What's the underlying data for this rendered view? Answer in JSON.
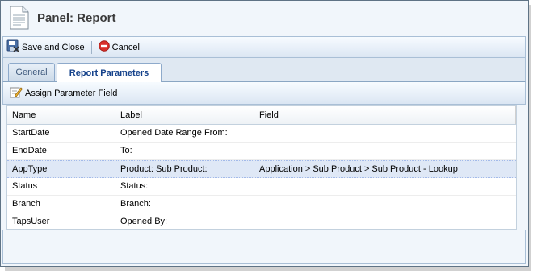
{
  "panel": {
    "title": "Panel: Report"
  },
  "toolbar": {
    "save_close_label": "Save and Close",
    "cancel_label": "Cancel"
  },
  "tabs": [
    {
      "label": "General",
      "active": false
    },
    {
      "label": "Report Parameters",
      "active": true
    }
  ],
  "sub_toolbar": {
    "assign_label": "Assign Parameter Field"
  },
  "grid": {
    "columns": [
      "Name",
      "Label",
      "Field"
    ],
    "rows": [
      {
        "name": "StartDate",
        "label": "Opened Date Range From:",
        "field": ""
      },
      {
        "name": "EndDate",
        "label": "To:",
        "field": ""
      },
      {
        "name": "AppType",
        "label": "Product: Sub Product:",
        "field": "Application > Sub Product > Sub Product - Lookup",
        "selected": true
      },
      {
        "name": "Status",
        "label": "Status:",
        "field": ""
      },
      {
        "name": "Branch",
        "label": "Branch:",
        "field": ""
      },
      {
        "name": "TapsUser",
        "label": "Opened By:",
        "field": ""
      }
    ]
  },
  "colors": {
    "accent": "#15428b",
    "selected_row": "#dfe8f6",
    "cancel_icon": "#d9302b"
  },
  "icons": {
    "document": "document-icon",
    "save": "save-close-icon",
    "cancel": "cancel-icon",
    "assign": "edit-pencil-icon"
  }
}
